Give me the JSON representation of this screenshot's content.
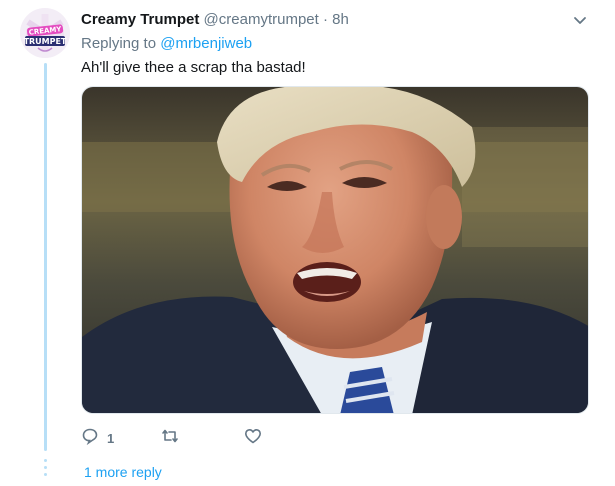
{
  "tweet": {
    "display_name": "Creamy Trumpet",
    "handle": "@creamytrumpet",
    "separator": "·",
    "time": "8h",
    "replying_prefix": "Replying to",
    "replying_to": "@mrbenjiweb",
    "text": "Ah'll give thee a scrap tha bastad!",
    "avatar_logo_text": [
      "CREAMY",
      "TRUMPET"
    ]
  },
  "actions": {
    "reply_count": "1",
    "retweet_count": "",
    "like_count": ""
  },
  "thread": {
    "more_replies_label": "1 more reply"
  },
  "icons": {
    "reply": "reply-icon",
    "retweet": "retweet-icon",
    "like": "heart-icon",
    "menu": "chevron-down-icon"
  },
  "colors": {
    "link": "#1da1f2",
    "muted": "#657786",
    "thread_line": "#b7dff7"
  }
}
